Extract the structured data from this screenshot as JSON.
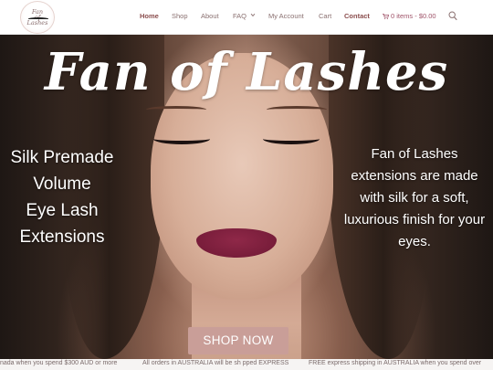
{
  "logo": {
    "text_line1": "Fan",
    "text_line2": "of",
    "text_line3": "Lashes"
  },
  "nav": {
    "items": [
      {
        "label": "Home"
      },
      {
        "label": "Shop"
      },
      {
        "label": "About"
      },
      {
        "label": "FAQ"
      },
      {
        "label": "My Account"
      },
      {
        "label": "Cart"
      },
      {
        "label": "Contact"
      }
    ],
    "cart_summary": "0 items - $0.00"
  },
  "hero": {
    "title": "Fan of Lashes",
    "left_lines": [
      "Silk Premade",
      "Volume",
      "Eye Lash",
      "Extensions"
    ],
    "right_text": "Fan of Lashes extensions are made with silk for a soft, luxurious finish for your eyes.",
    "shop_button": "SHOP NOW"
  },
  "ticker": {
    "messages": [
      "nada when you spend $300 AUD or more",
      "All orders in AUSTRALIA will be sh pped EXPRESS",
      "FREE express shipping in AUSTRALIA when you spend over"
    ]
  },
  "colors": {
    "accent": "#8b4e4e",
    "button": "#c99e98",
    "nav_text": "#8a7070"
  }
}
